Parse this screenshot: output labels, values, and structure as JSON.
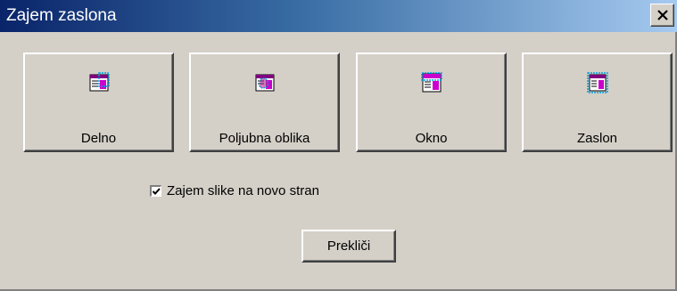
{
  "window": {
    "title": "Zajem zaslona",
    "close_icon": "close-icon"
  },
  "capture_buttons": [
    {
      "label": "Delno",
      "icon": "partial-capture-icon"
    },
    {
      "label": "Poljubna oblika",
      "icon": "freeform-capture-icon"
    },
    {
      "label": "Okno",
      "icon": "window-capture-icon"
    },
    {
      "label": "Zaslon",
      "icon": "screen-capture-icon"
    }
  ],
  "option": {
    "label": "Zajem slike na novo stran",
    "checked": true
  },
  "cancel_button": {
    "label": "Prekliči"
  },
  "colors": {
    "title_start": "#0a246a",
    "title_end": "#a6caf0",
    "face": "#d4d0c8",
    "icon_accent": "#cc00cc",
    "icon_selection": "#00a0e0"
  }
}
